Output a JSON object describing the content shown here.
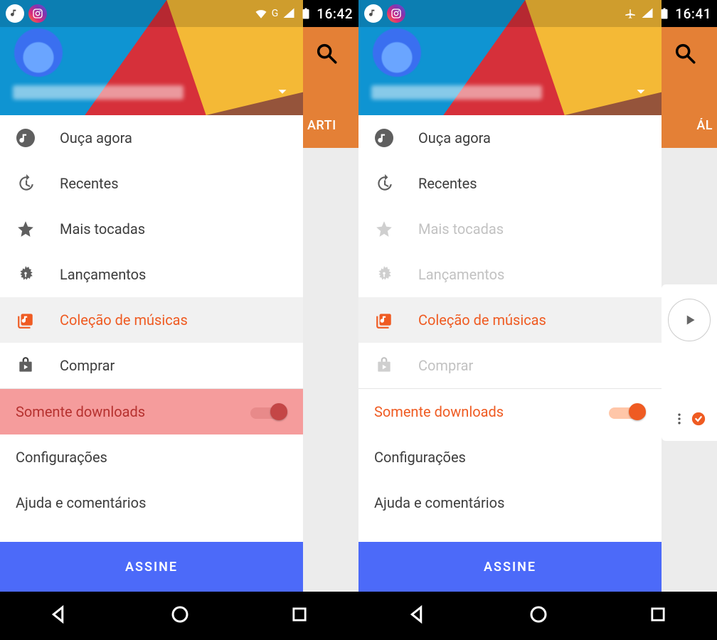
{
  "statusLeft": {
    "appBadge1": "play-music",
    "appBadge2": "instagram"
  },
  "left": {
    "statusTime": "16:42",
    "gLabel": "G",
    "hasWifi": true,
    "airplane": false,
    "backpaneTab": "ARTI",
    "menu": {
      "listen_now": "Ouça agora",
      "recents": "Recentes",
      "top": "Mais tocadas",
      "releases": "Lançamentos",
      "library": "Coleção de músicas",
      "shop": "Comprar"
    },
    "downloadsOnly": "Somente downloads",
    "settings": "Configurações",
    "help": "Ajuda e comentários",
    "subscribe": "ASSINE"
  },
  "right": {
    "statusTime": "16:41",
    "airplane": true,
    "hasWifi": false,
    "backpaneTab": "ÁL",
    "menu": {
      "listen_now": "Ouça agora",
      "recents": "Recentes",
      "top": "Mais tocadas",
      "releases": "Lançamentos",
      "library": "Coleção de músicas",
      "shop": "Comprar"
    },
    "downloadsOnly": "Somente downloads",
    "settings": "Configurações",
    "help": "Ajuda e comentários",
    "subscribe": "ASSINE"
  },
  "colors": {
    "accent": "#EF5B22",
    "subscribe": "#4C6AF9",
    "highlight": "#F59C9C"
  }
}
